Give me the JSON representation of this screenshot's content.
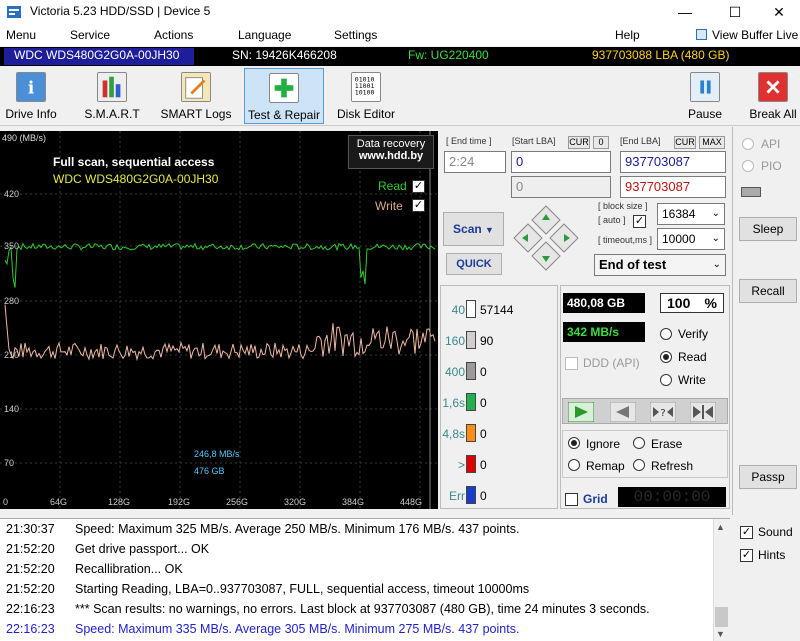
{
  "window": {
    "title": "Victoria 5.23 HDD/SSD | Device 5",
    "minimize": "—",
    "maximize": "☐",
    "close": "✕"
  },
  "menu": [
    "Menu",
    "Service",
    "Actions",
    "Language",
    "Settings",
    "Help"
  ],
  "view_buffer": "View Buffer Live",
  "device": {
    "model": "WDC WDS480G2G0A-00JH30",
    "serial": "SN: 19426K466208",
    "firmware": "Fw: UG220400",
    "lba": "937703088 LBA (480 GB)"
  },
  "toolbar": {
    "drive_info": "Drive Info",
    "smart": "S.M.A.R.T",
    "smart_logs": "SMART Logs",
    "test_repair": "Test & Repair",
    "disk_editor": "Disk Editor",
    "pause": "Pause",
    "break_all": "Break All"
  },
  "graph": {
    "title": "Full scan, sequential access",
    "model": "WDC WDS480G2G0A-00JH30",
    "unit": "490 (MB/s)",
    "banner1": "Data recovery",
    "banner2": "www.hdd.by",
    "read": "Read",
    "write": "Write",
    "cursor_speed": "246,8 MB/s",
    "cursor_pos": "476 GB",
    "yticks": [
      "420",
      "350",
      "280",
      "210",
      "140",
      "70"
    ],
    "xticks": [
      "0",
      "64G",
      "128G",
      "192G",
      "256G",
      "320G",
      "384G",
      "448G"
    ]
  },
  "controls": {
    "end_time_label": "[ End time ]",
    "end_time": "2:24",
    "start_lba_label": "[Start LBA]",
    "cur": "CUR",
    "zero": "0",
    "end_lba_label": "[End LBA]",
    "max": "MAX",
    "start_lba": "0",
    "end_lba": "937703087",
    "start_lba2": "0",
    "end_lba2": "937703087",
    "block_size_label": "[ block size ]",
    "auto_label": "[ auto ]",
    "block_size": "16384",
    "timeout_label": "[ timeout,ms ]",
    "timeout": "10000",
    "scan": "Scan",
    "quick": "QUICK",
    "end_of_test": "End of test"
  },
  "stats": {
    "rows": [
      {
        "label": "40",
        "count": "57144",
        "color": "#ffffff"
      },
      {
        "label": "160",
        "count": "90",
        "color": "#cfcfcf"
      },
      {
        "label": "400",
        "count": "0",
        "color": "#9a9a9a"
      },
      {
        "label": "1,6s",
        "count": "0",
        "color": "#22b14c"
      },
      {
        "label": "4,8s",
        "count": "0",
        "color": "#ff8c1a"
      },
      {
        "label": ">",
        "count": "0",
        "color": "#e00000"
      },
      {
        "label": "Err",
        "count": "0",
        "color": "#1a3cc8"
      }
    ]
  },
  "progress": {
    "size": "480,08 GB",
    "percent": "100",
    "pct_sign": "%",
    "speed": "342 MB/s",
    "ddd": "DDD (API)",
    "verify": "Verify",
    "read": "Read",
    "write": "Write",
    "ignore": "Ignore",
    "erase": "Erase",
    "remap": "Remap",
    "refresh": "Refresh",
    "grid": "Grid",
    "timer": "00:00:00"
  },
  "side": {
    "api": "API",
    "pio": "PIO",
    "sleep": "Sleep",
    "recall": "Recall",
    "passp": "Passp",
    "sound": "Sound",
    "hints": "Hints"
  },
  "log": [
    {
      "time": "21:30:37",
      "text": "Speed: Maximum 325 MB/s. Average 250 MB/s. Minimum 176 MB/s. 437 points.",
      "color": "#000"
    },
    {
      "time": "21:52:20",
      "text": "Get drive passport... OK",
      "color": "#000"
    },
    {
      "time": "21:52:20",
      "text": "Recallibration... OK",
      "color": "#000"
    },
    {
      "time": "21:52:20",
      "text": "Starting Reading, LBA=0..937703087, FULL, sequential access, timeout 10000ms",
      "color": "#000"
    },
    {
      "time": "22:16:23",
      "text": "*** Scan results: no warnings, no errors. Last block at 937703087 (480 GB), time 24 minutes 3 seconds.",
      "color": "#000"
    },
    {
      "time": "22:16:23",
      "text": "Speed: Maximum 335 MB/s. Average 305 MB/s. Minimum 275 MB/s. 437 points.",
      "color": "#1f1fcc"
    }
  ]
}
